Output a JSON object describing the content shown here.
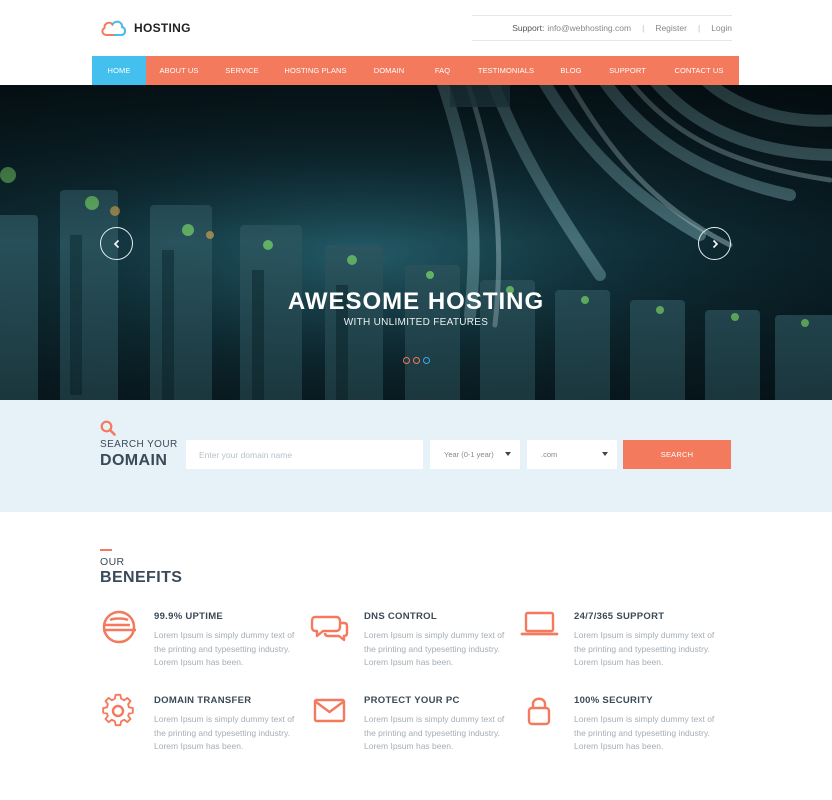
{
  "brand": {
    "name": "HOSTING",
    "accent": "#f47a5e",
    "active": "#43c0ee"
  },
  "toplinks": {
    "support_label": "Support:",
    "support_email": "info@webhosting.com",
    "register": "Register",
    "login": "Login"
  },
  "nav": {
    "items": [
      {
        "label": "HOME",
        "active": true
      },
      {
        "label": "ABOUT US"
      },
      {
        "label": "SERVICE"
      },
      {
        "label": "HOSTING PLANS"
      },
      {
        "label": "DOMAIN"
      },
      {
        "label": "FAQ"
      },
      {
        "label": "TESTIMONIALS"
      },
      {
        "label": "BLOG"
      },
      {
        "label": "SUPPORT"
      },
      {
        "label": "CONTACT US"
      }
    ]
  },
  "hero": {
    "title": "AWESOME HOSTING",
    "subtitle": "WITH UNLIMITED FEATURES",
    "prev_icon": "chevron-left-icon",
    "next_icon": "chevron-right-icon",
    "slides_total": 3,
    "slide_active": 3
  },
  "search": {
    "label_line1": "SEARCH YOUR",
    "label_line2": "DOMAIN",
    "input_placeholder": "Enter your domain name",
    "input_value": "",
    "year_select": "Year (0-1 year)",
    "tld_select": ".com",
    "button": "SEARCH"
  },
  "benefits": {
    "eyebrow": "OUR",
    "title": "BENEFITS",
    "items": [
      {
        "icon": "uptime-icon",
        "title": "99.9% UPTIME",
        "text": "Lorem Ipsum is simply dummy text of the printing and typesetting industry. Lorem Ipsum has been."
      },
      {
        "icon": "chat-bubbles-icon",
        "title": "DNS CONTROL",
        "text": "Lorem Ipsum is simply dummy text of the printing and typesetting industry. Lorem Ipsum has been."
      },
      {
        "icon": "laptop-icon",
        "title": "24/7/365 SUPPORT",
        "text": "Lorem Ipsum is simply dummy text of the printing and typesetting industry. Lorem Ipsum has been."
      },
      {
        "icon": "gear-icon",
        "title": "DOMAIN TRANSFER",
        "text": "Lorem Ipsum is simply dummy text of the printing and typesetting industry. Lorem Ipsum has been."
      },
      {
        "icon": "envelope-icon",
        "title": "PROTECT YOUR PC",
        "text": "Lorem Ipsum is simply dummy text of the printing and typesetting industry. Lorem Ipsum has been."
      },
      {
        "icon": "padlock-icon",
        "title": "100% SECURITY",
        "text": "Lorem Ipsum is simply dummy text of the printing and typesetting industry. Lorem Ipsum has been."
      }
    ]
  }
}
